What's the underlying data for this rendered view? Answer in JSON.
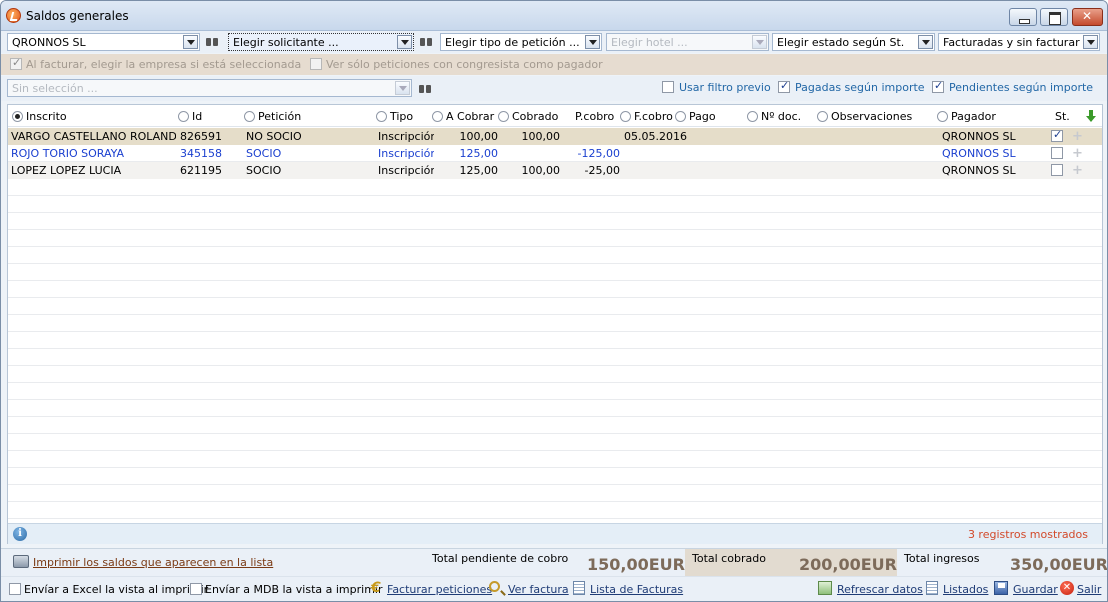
{
  "window": {
    "title": "Saldos generales"
  },
  "filters": {
    "empresa": "QRONNOS SL",
    "solicitante_placeholder": "Elegir solicitante ...",
    "tipo_peticion": "Elegir tipo de petición ...",
    "hotel": "Elegir hotel ...",
    "estado": "Elegir estado según St.",
    "facturacion": "Facturadas y sin facturar"
  },
  "options": {
    "al_facturar": "Al facturar, elegir la empresa si está seleccionada",
    "ver_solo": "Ver sólo peticiones con congresista como pagador"
  },
  "row2": {
    "seleccion": "Sin selección ...",
    "usar_filtro": "Usar filtro previo",
    "pagadas": "Pagadas según importe",
    "pendientes": "Pendientes según importe"
  },
  "columns": {
    "inscrito": "Inscrito",
    "id": "Id",
    "peticion": "Petición",
    "tipo": "Tipo",
    "a_cobrar": "A Cobrar",
    "cobrado": "Cobrado",
    "p_cobro": "P.cobro",
    "f_cobro": "F.cobro",
    "pago": "Pago",
    "n_doc": "Nº doc.",
    "observaciones": "Observaciones",
    "pagador": "Pagador",
    "st": "St."
  },
  "rows": [
    {
      "inscrito": "VARGO CASTELLANO ROLANDO",
      "id": "826591",
      "peticion": "NO SOCIO",
      "tipo": "Inscripción",
      "a_cobrar": "100,00",
      "cobrado": "100,00",
      "p_cobro": "",
      "f_cobro": "05.05.2016",
      "pagador": "QRONNOS SL"
    },
    {
      "inscrito": "ROJO TORIO SORAYA",
      "id": "345158",
      "peticion": "SOCIO",
      "tipo": "Inscripción",
      "a_cobrar": "125,00",
      "cobrado": "",
      "p_cobro": "-125,00",
      "f_cobro": "",
      "pagador": "QRONNOS SL"
    },
    {
      "inscrito": "LOPEZ LOPEZ LUCIA",
      "id": "621195",
      "peticion": "SOCIO",
      "tipo": "Inscripción",
      "a_cobrar": "125,00",
      "cobrado": "100,00",
      "p_cobro": "-25,00",
      "f_cobro": "",
      "pagador": "QRONNOS SL"
    }
  ],
  "status": {
    "count": "3 registros mostrados"
  },
  "totals": {
    "print_label": "Imprimir los saldos que aparecen en la lista",
    "pendiente_label": "Total pendiente de cobro",
    "pendiente_value": "150,00EUR",
    "cobrado_label": "Total cobrado",
    "cobrado_value": "200,00EUR",
    "ingresos_label": "Total ingresos",
    "ingresos_value": "350,00EUR"
  },
  "bottom": {
    "excel": "Envíar a Excel la vista al imprimir",
    "mdb": "Envíar a MDB la vista a imprimir",
    "facturar": "Facturar peticiones",
    "ver_factura": "Ver factura",
    "lista_facturas": "Lista de Facturas",
    "refrescar": "Refrescar datos",
    "listados": "Listados",
    "guardar": "Guardar",
    "salir": "Salir"
  }
}
